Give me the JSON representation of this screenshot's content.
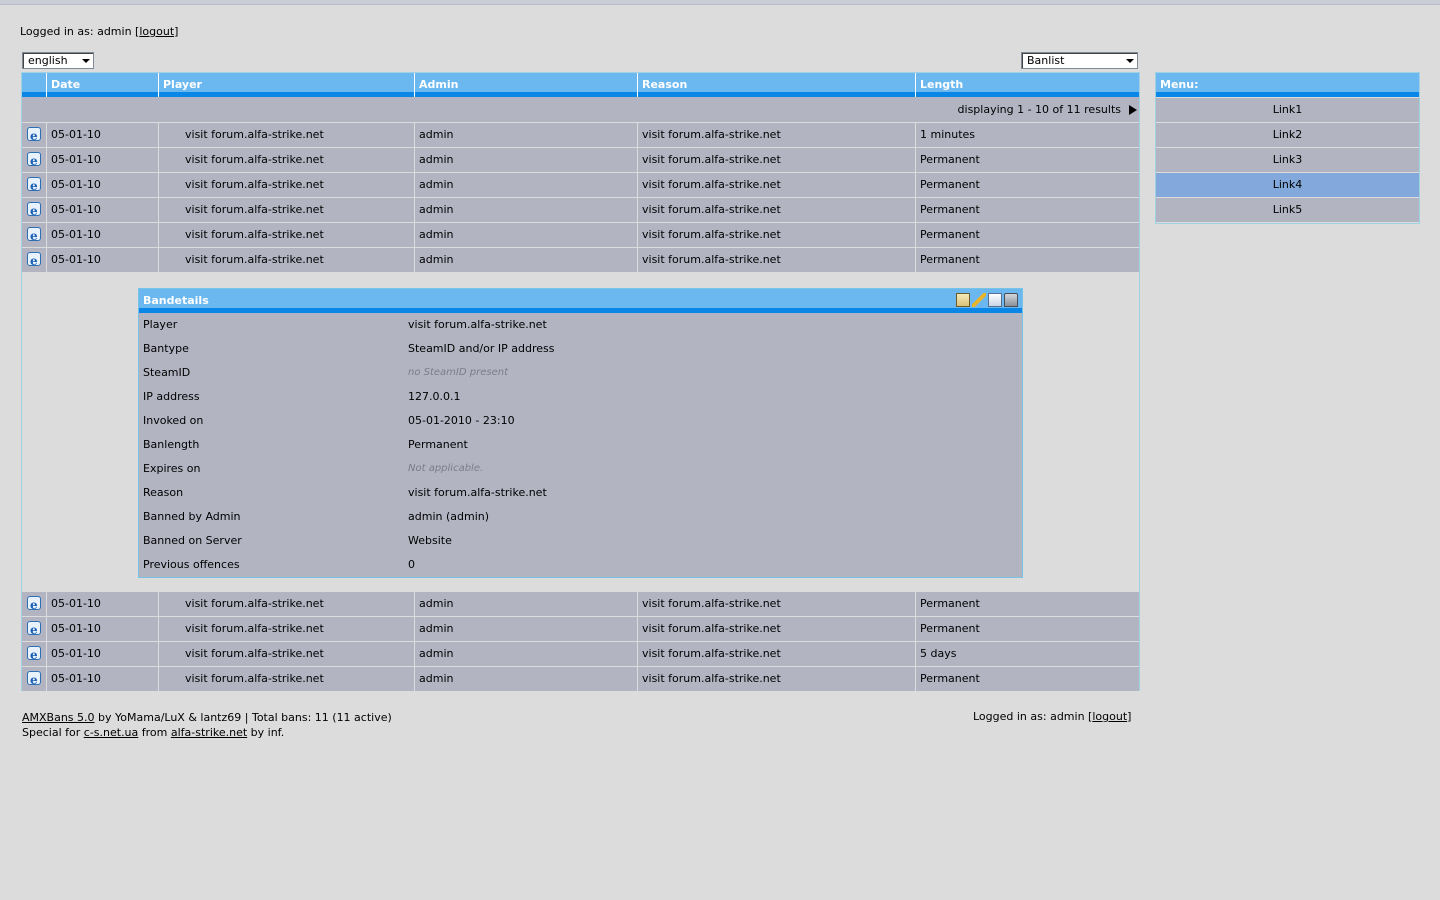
{
  "login": {
    "prefix": "Logged in as: admin [",
    "logout": "logout",
    "suffix": "]"
  },
  "language_select": {
    "value": "english"
  },
  "view_select": {
    "value": "Banlist"
  },
  "table": {
    "columns": [
      "",
      "Date",
      "Player",
      "Admin",
      "Reason",
      "Length"
    ],
    "pager_text": "displaying 1 - 10 of 11 results",
    "rows_before": [
      {
        "date": "05-01-10",
        "player": "visit forum.alfa-strike.net",
        "admin": "admin",
        "reason": "visit forum.alfa-strike.net",
        "length": "1 minutes"
      },
      {
        "date": "05-01-10",
        "player": "visit forum.alfa-strike.net",
        "admin": "admin",
        "reason": "visit forum.alfa-strike.net",
        "length": "Permanent"
      },
      {
        "date": "05-01-10",
        "player": "visit forum.alfa-strike.net",
        "admin": "admin",
        "reason": "visit forum.alfa-strike.net",
        "length": "Permanent"
      },
      {
        "date": "05-01-10",
        "player": "visit forum.alfa-strike.net",
        "admin": "admin",
        "reason": "visit forum.alfa-strike.net",
        "length": "Permanent"
      },
      {
        "date": "05-01-10",
        "player": "visit forum.alfa-strike.net",
        "admin": "admin",
        "reason": "visit forum.alfa-strike.net",
        "length": "Permanent"
      },
      {
        "date": "05-01-10",
        "player": "visit forum.alfa-strike.net",
        "admin": "admin",
        "reason": "visit forum.alfa-strike.net",
        "length": "Permanent"
      }
    ],
    "rows_after": [
      {
        "date": "05-01-10",
        "player": "visit forum.alfa-strike.net",
        "admin": "admin",
        "reason": "visit forum.alfa-strike.net",
        "length": "Permanent"
      },
      {
        "date": "05-01-10",
        "player": "visit forum.alfa-strike.net",
        "admin": "admin",
        "reason": "visit forum.alfa-strike.net",
        "length": "Permanent"
      },
      {
        "date": "05-01-10",
        "player": "visit forum.alfa-strike.net",
        "admin": "admin",
        "reason": "visit forum.alfa-strike.net",
        "length": "5 days"
      },
      {
        "date": "05-01-10",
        "player": "visit forum.alfa-strike.net",
        "admin": "admin",
        "reason": "visit forum.alfa-strike.net",
        "length": "Permanent"
      }
    ]
  },
  "bandetails": {
    "title": "Bandetails",
    "tools": [
      "details-icon",
      "edit-icon",
      "copy-icon",
      "delete-icon"
    ],
    "rows": [
      {
        "label": "Player",
        "value": "visit forum.alfa-strike.net",
        "muted": false
      },
      {
        "label": "Bantype",
        "value": "SteamID and/or IP address",
        "muted": false
      },
      {
        "label": "SteamID",
        "value": "no SteamID present",
        "muted": true
      },
      {
        "label": "IP address",
        "value": "127.0.0.1",
        "muted": false
      },
      {
        "label": "Invoked on",
        "value": "05-01-2010 - 23:10",
        "muted": false
      },
      {
        "label": "Banlength",
        "value": "Permanent",
        "muted": false
      },
      {
        "label": "Expires on",
        "value": "Not applicable.",
        "muted": true
      },
      {
        "label": "Reason",
        "value": "visit forum.alfa-strike.net",
        "muted": false
      },
      {
        "label": "Banned by Admin",
        "value": "admin (admin)",
        "muted": false
      },
      {
        "label": "Banned on Server",
        "value": "Website",
        "muted": false
      },
      {
        "label": "Previous offences",
        "value": "0",
        "muted": false
      }
    ]
  },
  "menu": {
    "title": "Menu:",
    "items": [
      "Link1",
      "Link2",
      "Link3",
      "Link4",
      "Link5"
    ],
    "active_index": 3
  },
  "footer": {
    "line1_link": "AMXBans 5.0",
    "line1_text": " by YoMama/LuX & lantz69 | Total bans: 11 (11 active)",
    "line2_prefix": "Special for ",
    "line2_link1": "c-s.net.ua",
    "line2_mid": " from ",
    "line2_link2": "alfa-strike.net",
    "line2_suffix": " by inf.",
    "right_prefix": "Logged in as: admin [",
    "right_logout": "logout",
    "right_suffix": "]"
  },
  "colors": {
    "header": "#6bb7f0",
    "header_bar": "#0a86e6",
    "row": "#b2b4c2",
    "menu_active": "#82a8dc"
  }
}
